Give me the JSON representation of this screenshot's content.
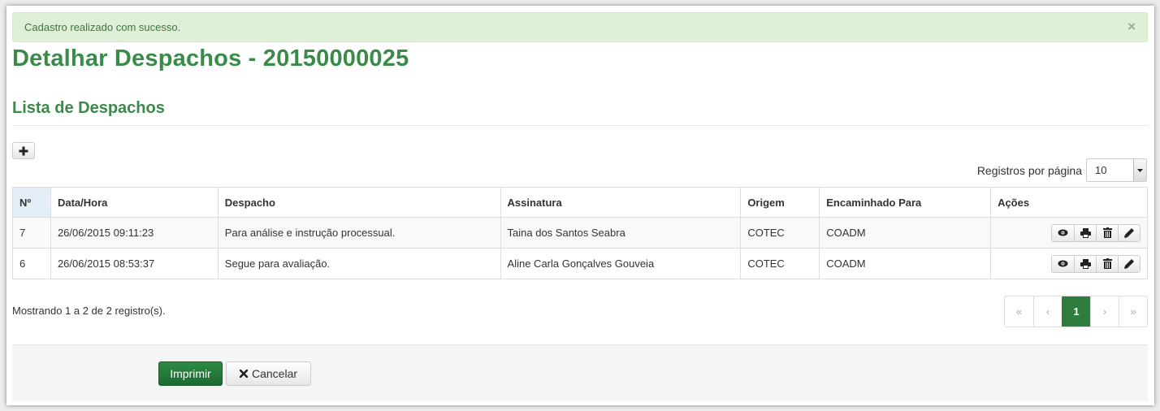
{
  "alert": {
    "message": "Cadastro realizado com sucesso.",
    "close": "×"
  },
  "page_title": "Detalhar Despachos - 20150000025",
  "section_title": "Lista de Despachos",
  "per_page": {
    "label": "Registros por página",
    "value": "10"
  },
  "table": {
    "headers": [
      "Nº",
      "Data/Hora",
      "Despacho",
      "Assinatura",
      "Origem",
      "Encaminhado Para",
      "Ações"
    ],
    "rows": [
      [
        "7",
        "26/06/2015 09:11:23",
        "Para análise e instrução processual.",
        "Taina dos Santos Seabra",
        "COTEC",
        "COADM"
      ],
      [
        "6",
        "26/06/2015 08:53:37",
        "Segue para avaliação.",
        "Aline Carla Gonçalves Gouveia",
        "COTEC",
        "COADM"
      ]
    ]
  },
  "showing": "Mostrando 1 a 2 de 2 registro(s).",
  "pagination": {
    "first": "«",
    "prev": "‹",
    "current": "1",
    "next": "›",
    "last": "»"
  },
  "footer": {
    "print_label": "Imprimir",
    "cancel_label": "Cancelar"
  },
  "colors": {
    "green_title": "#3a8a4a",
    "alert_bg": "#dff0d8",
    "primary_button": "#1b6a30"
  }
}
